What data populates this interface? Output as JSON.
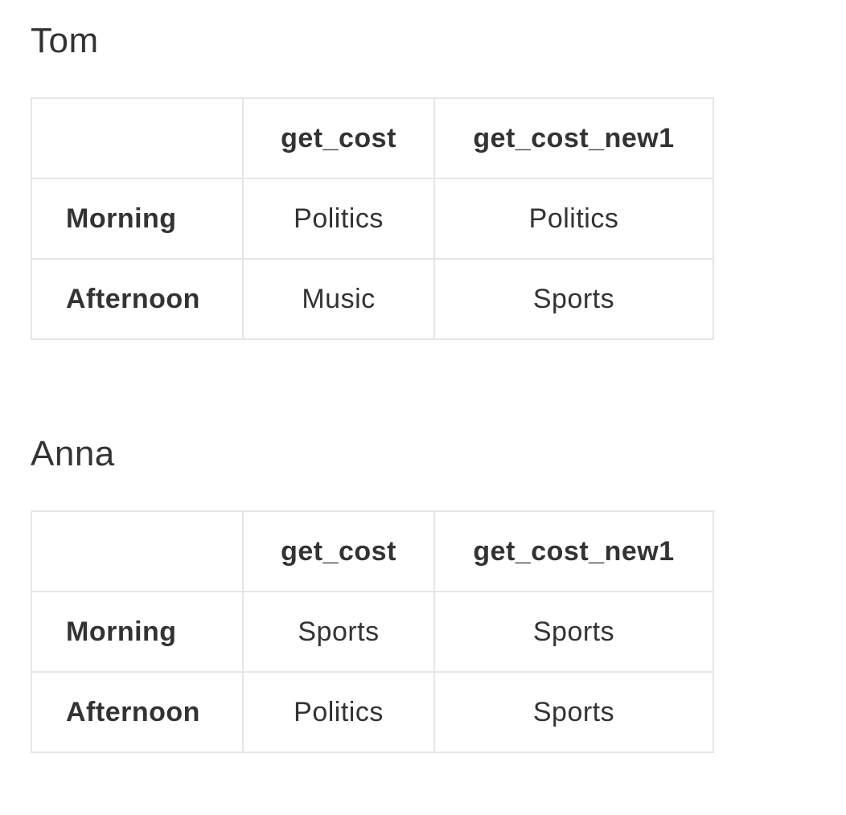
{
  "sections": [
    {
      "title": "Tom",
      "columns": [
        "",
        "get_cost",
        "get_cost_new1"
      ],
      "rows": [
        {
          "label": "Morning",
          "cells": [
            "Politics",
            "Politics"
          ]
        },
        {
          "label": "Afternoon",
          "cells": [
            "Music",
            "Sports"
          ]
        }
      ]
    },
    {
      "title": "Anna",
      "columns": [
        "",
        "get_cost",
        "get_cost_new1"
      ],
      "rows": [
        {
          "label": "Morning",
          "cells": [
            "Sports",
            "Sports"
          ]
        },
        {
          "label": "Afternoon",
          "cells": [
            "Politics",
            "Sports"
          ]
        }
      ]
    }
  ]
}
